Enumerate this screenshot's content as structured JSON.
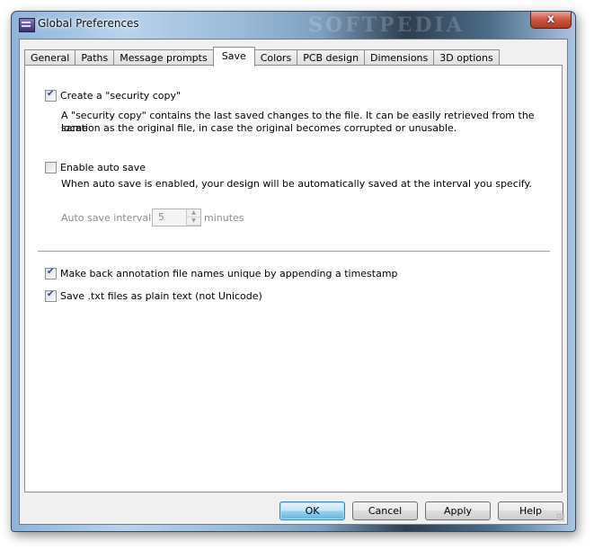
{
  "window": {
    "title": "Global Preferences",
    "close_symbol": "x",
    "watermark": "SOFTPEDIA"
  },
  "tabs": [
    {
      "label": "General",
      "active": false
    },
    {
      "label": "Paths",
      "active": false
    },
    {
      "label": "Message prompts",
      "active": false
    },
    {
      "label": "Save",
      "active": true
    },
    {
      "label": "Colors",
      "active": false
    },
    {
      "label": "PCB design",
      "active": false
    },
    {
      "label": "Dimensions",
      "active": false
    },
    {
      "label": "3D options",
      "active": false
    }
  ],
  "save": {
    "security_copy": {
      "label": "Create a \"security copy\"",
      "checked": true,
      "description_line1": "A \"security copy\" contains the last saved changes to the file. It can be easily retrieved from the same",
      "description_line2": "location as the original file, in case the original becomes corrupted or unusable."
    },
    "auto_save": {
      "label": "Enable auto save",
      "checked": false,
      "description": "When auto save is enabled, your design will be automatically saved at the interval you specify.",
      "interval_label": "Auto save interval:",
      "interval_value": "5",
      "interval_unit": "minutes",
      "spin_up": "▲",
      "spin_down": "▼"
    },
    "unique_names": {
      "label": "Make back annotation file names unique by appending a timestamp",
      "checked": true
    },
    "plain_text": {
      "label": "Save .txt files as plain text (not Unicode)",
      "checked": true
    }
  },
  "buttons": {
    "ok": "OK",
    "cancel": "Cancel",
    "apply": "Apply",
    "help": "Help"
  }
}
